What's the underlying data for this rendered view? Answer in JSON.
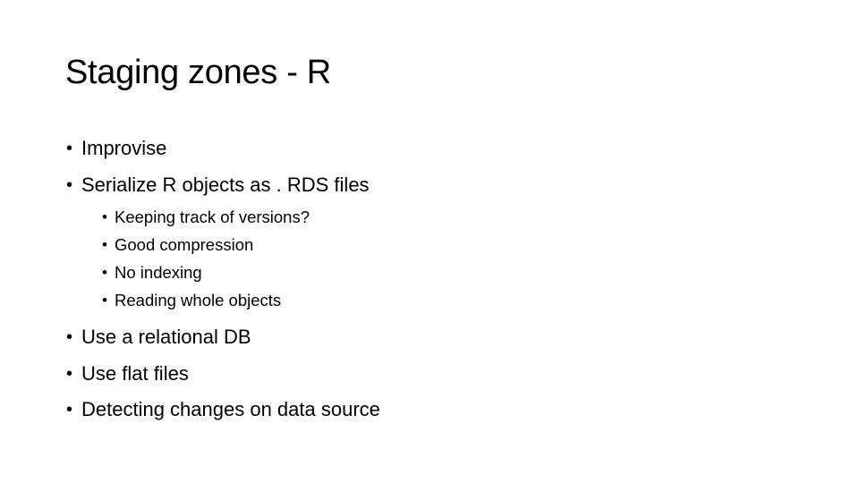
{
  "slide": {
    "title": "Staging zones - R",
    "bullet_glyph": "•",
    "items": [
      {
        "text": "Improvise"
      },
      {
        "text": "Serialize R objects as . RDS files",
        "children": [
          {
            "text": "Keeping track of versions?"
          },
          {
            "text": "Good compression"
          },
          {
            "text": "No indexing"
          },
          {
            "text": "Reading whole objects"
          }
        ]
      },
      {
        "text": "Use a relational DB"
      },
      {
        "text": "Use flat files"
      },
      {
        "text": "Detecting changes on data source"
      }
    ]
  }
}
